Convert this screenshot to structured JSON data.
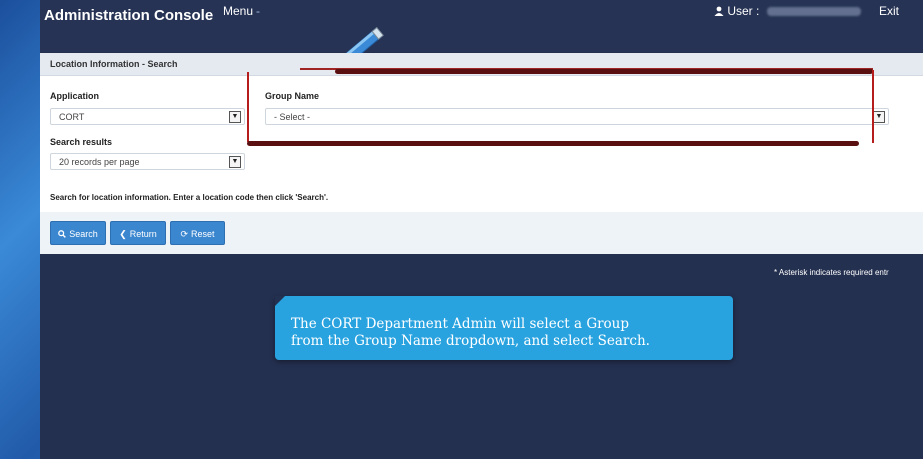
{
  "header": {
    "title": "Administration Console",
    "menu_label": "Menu",
    "menu_caret": "-",
    "user_label": "User :",
    "exit_label": "Exit"
  },
  "panel": {
    "heading": "Location Information - Search",
    "application": {
      "label": "Application",
      "value": "CORT"
    },
    "group_name": {
      "label": "Group Name",
      "value": "- Select -"
    },
    "search_results": {
      "label": "Search results",
      "value": "20 records per page"
    },
    "hint": "Search for location information. Enter a location code then click 'Search'."
  },
  "buttons": {
    "search": "Search",
    "return": "Return",
    "reset": "Reset"
  },
  "footer_note": "* Asterisk indicates required entr",
  "callout": {
    "line1": "The CORT Department Admin will select a Group",
    "line2": "from the Group Name dropdown, and select Search."
  },
  "colors": {
    "accent": "#3a86cf",
    "header_bg": "#263354",
    "callout_bg": "#29a3e0",
    "annotation_red": "#b51c1c"
  },
  "icons": [
    "user-icon",
    "search-icon",
    "chevron-left-icon",
    "refresh-icon",
    "pencil-icon",
    "chevron-down-icon"
  ]
}
